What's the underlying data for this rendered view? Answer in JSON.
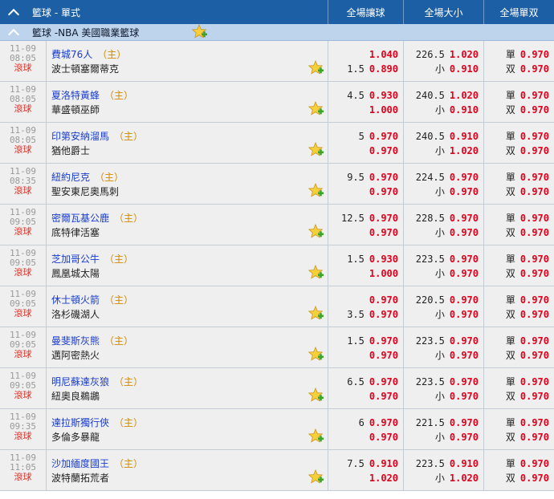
{
  "header": {
    "title": "籃球 - 單式",
    "col_handicap": "全場讓球",
    "col_ou": "全場大小",
    "col_oe": "全場單双"
  },
  "league": {
    "name": "籃球 -NBA 美國職業籃球"
  },
  "live_label": "滾球",
  "home_marker": "（主）",
  "icons": {
    "collapse": "chevron-up-icon",
    "favorite": "star-plus-icon"
  },
  "colors": {
    "header_bg": "#1d5fa4",
    "league_bg": "#bed3ec",
    "odds_red": "#e0001b",
    "team_blue": "#1a3ccf",
    "live_red": "#e8281c",
    "home_orange": "#d08a00"
  },
  "matches": [
    {
      "date": "11-09",
      "time": "08:05",
      "team1": "費城76人",
      "team2": "波士頓塞爾蒂克",
      "home": 1,
      "hcp": [
        {
          "line": "",
          "odds": "1.040"
        },
        {
          "line": "1.5",
          "odds": "0.890"
        }
      ],
      "ou": [
        {
          "line": "226.5",
          "odds": "1.020"
        },
        {
          "line": "小",
          "odds": "0.910"
        }
      ],
      "oe": [
        {
          "line": "單",
          "odds": "0.970"
        },
        {
          "line": "双",
          "odds": "0.970"
        }
      ]
    },
    {
      "date": "11-09",
      "time": "08:05",
      "team1": "夏洛特黃蜂",
      "team2": "華盛頓巫師",
      "home": 1,
      "hcp": [
        {
          "line": "4.5",
          "odds": "0.930"
        },
        {
          "line": "",
          "odds": "1.000"
        }
      ],
      "ou": [
        {
          "line": "240.5",
          "odds": "1.020"
        },
        {
          "line": "小",
          "odds": "0.910"
        }
      ],
      "oe": [
        {
          "line": "單",
          "odds": "0.970"
        },
        {
          "line": "双",
          "odds": "0.970"
        }
      ]
    },
    {
      "date": "11-09",
      "time": "08:05",
      "team1": "印第安納溜馬",
      "team2": "猶他爵士",
      "home": 1,
      "hcp": [
        {
          "line": "5",
          "odds": "0.970"
        },
        {
          "line": "",
          "odds": "0.970"
        }
      ],
      "ou": [
        {
          "line": "240.5",
          "odds": "0.910"
        },
        {
          "line": "小",
          "odds": "1.020"
        }
      ],
      "oe": [
        {
          "line": "單",
          "odds": "0.970"
        },
        {
          "line": "双",
          "odds": "0.970"
        }
      ]
    },
    {
      "date": "11-09",
      "time": "08:35",
      "team1": "紐約尼克",
      "team2": "聖安東尼奧馬刺",
      "home": 1,
      "hcp": [
        {
          "line": "9.5",
          "odds": "0.970"
        },
        {
          "line": "",
          "odds": "0.970"
        }
      ],
      "ou": [
        {
          "line": "224.5",
          "odds": "0.970"
        },
        {
          "line": "小",
          "odds": "0.970"
        }
      ],
      "oe": [
        {
          "line": "單",
          "odds": "0.970"
        },
        {
          "line": "双",
          "odds": "0.970"
        }
      ]
    },
    {
      "date": "11-09",
      "time": "09:05",
      "team1": "密爾瓦基公鹿",
      "team2": "底特律活塞",
      "home": 1,
      "hcp": [
        {
          "line": "12.5",
          "odds": "0.970"
        },
        {
          "line": "",
          "odds": "0.970"
        }
      ],
      "ou": [
        {
          "line": "228.5",
          "odds": "0.970"
        },
        {
          "line": "小",
          "odds": "0.970"
        }
      ],
      "oe": [
        {
          "line": "單",
          "odds": "0.970"
        },
        {
          "line": "双",
          "odds": "0.970"
        }
      ]
    },
    {
      "date": "11-09",
      "time": "09:05",
      "team1": "芝加哥公牛",
      "team2": "鳳凰城太陽",
      "home": 1,
      "hcp": [
        {
          "line": "1.5",
          "odds": "0.930"
        },
        {
          "line": "",
          "odds": "1.000"
        }
      ],
      "ou": [
        {
          "line": "223.5",
          "odds": "0.970"
        },
        {
          "line": "小",
          "odds": "0.970"
        }
      ],
      "oe": [
        {
          "line": "單",
          "odds": "0.970"
        },
        {
          "line": "双",
          "odds": "0.970"
        }
      ]
    },
    {
      "date": "11-09",
      "time": "09:05",
      "team1": "休士頓火箭",
      "team2": "洛杉磯湖人",
      "home": 1,
      "hcp": [
        {
          "line": "",
          "odds": "0.970"
        },
        {
          "line": "3.5",
          "odds": "0.970"
        }
      ],
      "ou": [
        {
          "line": "220.5",
          "odds": "0.970"
        },
        {
          "line": "小",
          "odds": "0.970"
        }
      ],
      "oe": [
        {
          "line": "單",
          "odds": "0.970"
        },
        {
          "line": "双",
          "odds": "0.970"
        }
      ]
    },
    {
      "date": "11-09",
      "time": "09:05",
      "team1": "曼斐斯灰熊",
      "team2": "邁阿密熱火",
      "home": 1,
      "hcp": [
        {
          "line": "1.5",
          "odds": "0.970"
        },
        {
          "line": "",
          "odds": "0.970"
        }
      ],
      "ou": [
        {
          "line": "223.5",
          "odds": "0.970"
        },
        {
          "line": "小",
          "odds": "0.970"
        }
      ],
      "oe": [
        {
          "line": "單",
          "odds": "0.970"
        },
        {
          "line": "双",
          "odds": "0.970"
        }
      ]
    },
    {
      "date": "11-09",
      "time": "09:05",
      "team1": "明尼蘇達灰狼",
      "team2": "紐奧良鵜鶘",
      "home": 1,
      "hcp": [
        {
          "line": "6.5",
          "odds": "0.970"
        },
        {
          "line": "",
          "odds": "0.970"
        }
      ],
      "ou": [
        {
          "line": "223.5",
          "odds": "0.970"
        },
        {
          "line": "小",
          "odds": "0.970"
        }
      ],
      "oe": [
        {
          "line": "單",
          "odds": "0.970"
        },
        {
          "line": "双",
          "odds": "0.970"
        }
      ]
    },
    {
      "date": "11-09",
      "time": "09:35",
      "team1": "達拉斯獨行俠",
      "team2": "多倫多暴龍",
      "home": 1,
      "hcp": [
        {
          "line": "6",
          "odds": "0.970"
        },
        {
          "line": "",
          "odds": "0.970"
        }
      ],
      "ou": [
        {
          "line": "221.5",
          "odds": "0.970"
        },
        {
          "line": "小",
          "odds": "0.970"
        }
      ],
      "oe": [
        {
          "line": "單",
          "odds": "0.970"
        },
        {
          "line": "双",
          "odds": "0.970"
        }
      ]
    },
    {
      "date": "11-09",
      "time": "11:05",
      "team1": "沙加緬度國王",
      "team2": "波特蘭拓荒者",
      "home": 1,
      "hcp": [
        {
          "line": "7.5",
          "odds": "0.910"
        },
        {
          "line": "",
          "odds": "1.020"
        }
      ],
      "ou": [
        {
          "line": "223.5",
          "odds": "0.910"
        },
        {
          "line": "小",
          "odds": "1.020"
        }
      ],
      "oe": [
        {
          "line": "單",
          "odds": "0.970"
        },
        {
          "line": "双",
          "odds": "0.970"
        }
      ]
    }
  ]
}
